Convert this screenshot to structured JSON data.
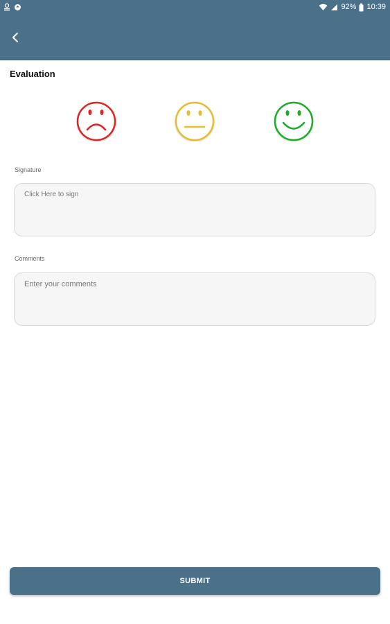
{
  "status_bar": {
    "battery_percent": "92%",
    "time": "10:39",
    "icons": [
      "notification-icon",
      "sync-icon",
      "wifi-icon",
      "signal-icon",
      "battery-icon"
    ]
  },
  "app_bar": {
    "back_icon": "chevron-left-icon",
    "color": "#4a7189"
  },
  "evaluation": {
    "title": "Evaluation",
    "options": [
      {
        "name": "sad",
        "color": "#e02424"
      },
      {
        "name": "neutral",
        "color": "#e6bd2e"
      },
      {
        "name": "happy",
        "color": "#1faa2a"
      }
    ]
  },
  "signature": {
    "label": "Signature",
    "placeholder": "Click Here to sign"
  },
  "comments": {
    "label": "Comments",
    "placeholder": "Enter your comments"
  },
  "submit": {
    "label": "SUBMIT"
  }
}
